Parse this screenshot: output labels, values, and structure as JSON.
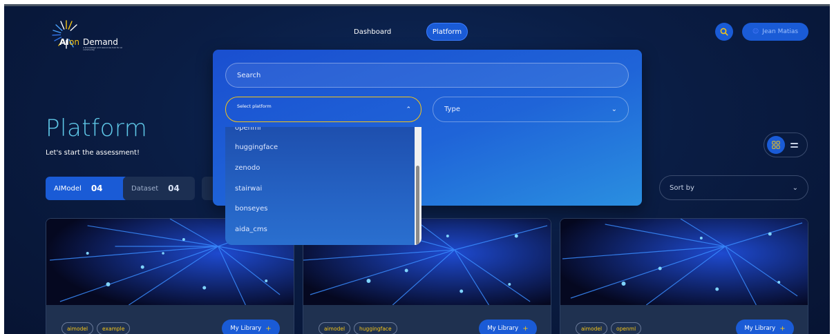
{
  "header": {
    "logo": {
      "part1": "AI",
      "part2": "on",
      "part3": "Demand",
      "tagline": "a knowledge and resources hub for AI community"
    },
    "nav": [
      {
        "label": "Dashboard"
      },
      {
        "label": "Platform"
      }
    ],
    "user": {
      "name": "Jean Matias"
    }
  },
  "page": {
    "title": "Platform",
    "subtitle": "Let's start the assessment!",
    "tabs": [
      {
        "label": "AIModel",
        "count": "04"
      },
      {
        "label": "Dataset",
        "count": "04"
      }
    ],
    "sort": {
      "label": "Sort by"
    }
  },
  "filter_panel": {
    "search_placeholder": "Search",
    "platform_select": {
      "label": "Select platform"
    },
    "type_select": {
      "label": "Type"
    },
    "platform_options": [
      "openml",
      "huggingface",
      "zenodo",
      "stairwai",
      "bonseyes",
      "aida_cms"
    ]
  },
  "cards": [
    {
      "tags": [
        "aimodel",
        "example"
      ],
      "button": "My Library"
    },
    {
      "tags": [
        "aimodel",
        "huggingface"
      ],
      "button": "My Library"
    },
    {
      "tags": [
        "aimodel",
        "openml"
      ],
      "button": "My Library"
    }
  ],
  "colors": {
    "accent": "#1a5bd6",
    "highlight": "#f5c518",
    "title": "#5fc8e8",
    "background": "#0a1d44"
  },
  "icons": [
    "search-icon",
    "user-icon",
    "grid-view-icon",
    "list-view-icon",
    "chevron-up-icon",
    "chevron-down-icon",
    "plus-icon"
  ]
}
